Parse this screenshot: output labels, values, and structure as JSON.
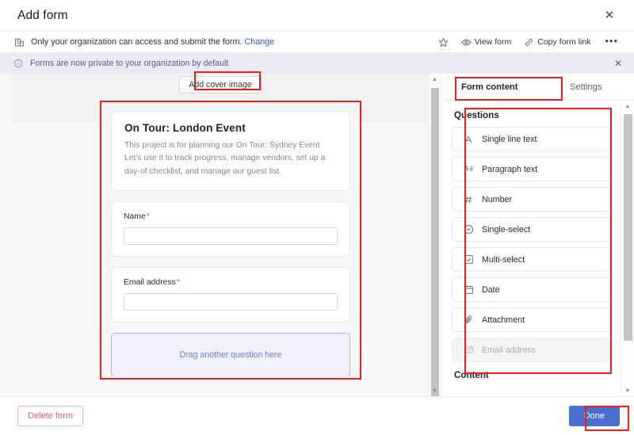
{
  "window": {
    "title": "Add form",
    "close_label": "✕"
  },
  "permission_bar": {
    "icon": "organization-icon",
    "text": "Only your organization can access and submit the form.",
    "link_label": "Change",
    "actions": [
      {
        "icon": "star-icon",
        "label": ""
      },
      {
        "icon": "eye-icon",
        "label": "View form"
      },
      {
        "icon": "link-icon",
        "label": "Copy form link"
      },
      {
        "icon": "more-icon",
        "label": "•••"
      }
    ]
  },
  "info_banner": {
    "icon": "info-icon",
    "text": "Forms are now private to your organization by default",
    "close_label": "✕",
    "background": "#eceaf7",
    "text_color": "#5c5a8a"
  },
  "form_canvas": {
    "add_cover_label": "Add cover image",
    "title": "On Tour: London Event",
    "description": "This project is for planning our On Tour: Sydney Event Let's use it to track progress, manage vendors, set up a day-of checklist, and manage our guest list.",
    "fields": [
      {
        "label": "Name",
        "required": true,
        "value": ""
      },
      {
        "label": "Email address",
        "required": true,
        "value": ""
      }
    ],
    "drop_zone_label": "Drag another question here",
    "drop_zone_color": "#6b7fd0"
  },
  "right_panel": {
    "tabs": [
      {
        "label": "Form content",
        "active": true
      },
      {
        "label": "Settings",
        "active": false
      }
    ],
    "questions_title": "Questions",
    "question_types": [
      {
        "label": "Single line text",
        "icon": "text-a-icon",
        "glyph": "A",
        "disabled": false
      },
      {
        "label": "Paragraph text",
        "icon": "paragraph-icon",
        "glyph": "A≡",
        "disabled": false
      },
      {
        "label": "Number",
        "icon": "hash-icon",
        "glyph": "#",
        "disabled": false
      },
      {
        "label": "Single-select",
        "icon": "chevron-circle-icon",
        "glyph": "",
        "disabled": false
      },
      {
        "label": "Multi-select",
        "icon": "checkbox-icon",
        "glyph": "",
        "disabled": false
      },
      {
        "label": "Date",
        "icon": "calendar-icon",
        "glyph": "",
        "disabled": false
      },
      {
        "label": "Attachment",
        "icon": "paperclip-icon",
        "glyph": "",
        "disabled": false
      },
      {
        "label": "Email address",
        "icon": "envelope-icon",
        "glyph": "",
        "disabled": true
      }
    ],
    "content_title": "Content"
  },
  "footer": {
    "delete_label": "Delete form",
    "done_label": "Done",
    "done_color": "#4a6ecb",
    "delete_color": "#e05c72"
  },
  "annotations": {
    "color": "#f01b1b",
    "boxes": [
      {
        "name": "add-cover-image-highlight"
      },
      {
        "name": "form-canvas-highlight"
      },
      {
        "name": "form-content-tab-highlight"
      },
      {
        "name": "questions-list-highlight"
      },
      {
        "name": "done-button-highlight"
      }
    ]
  }
}
